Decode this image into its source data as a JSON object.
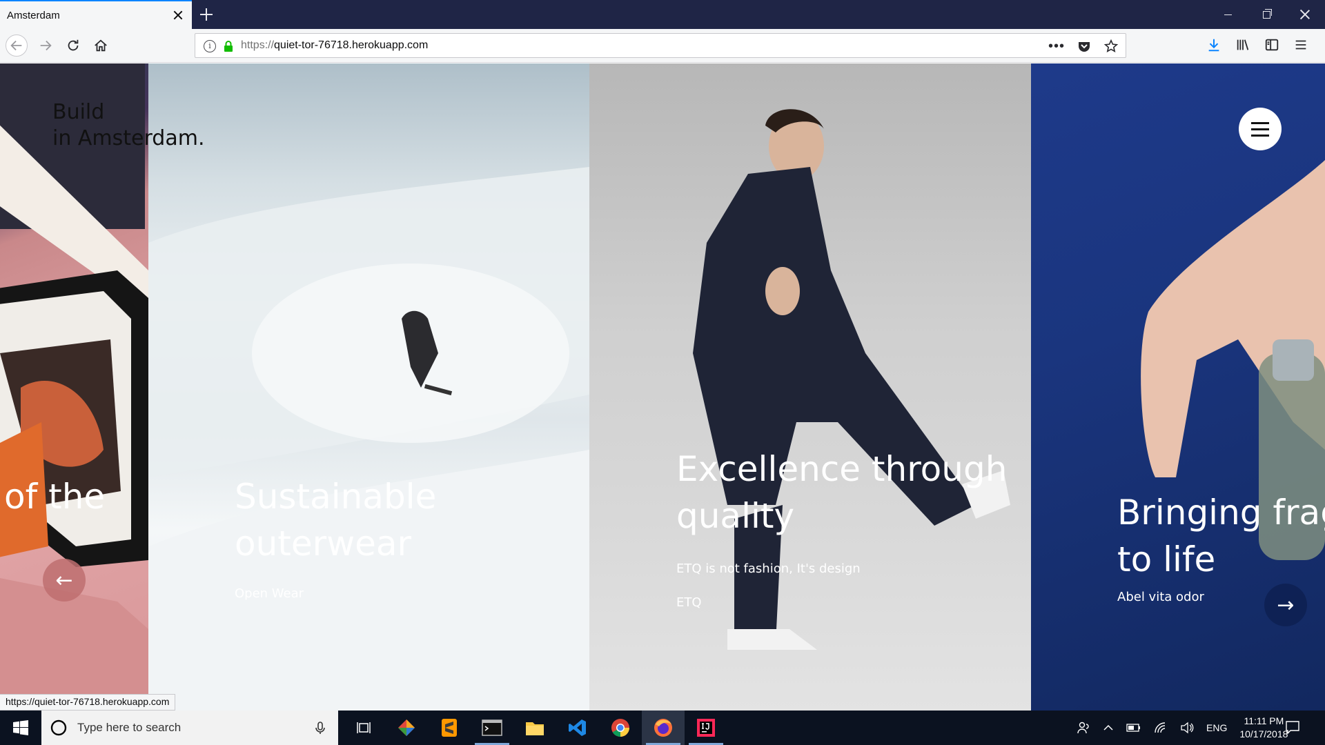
{
  "browser": {
    "tab_title": "Amsterdam",
    "url_scheme": "https://",
    "url_host": "quiet-tor-76718.herokuapp.com",
    "status_url": "https://quiet-tor-76718.herokuapp.com"
  },
  "page": {
    "brand_line1": "Build",
    "brand_line2": "in Amsterdam.",
    "slides": [
      {
        "title": "of the",
        "subtitle": "",
        "brand": ""
      },
      {
        "title_line1": "Sustainable",
        "title_line2": "outerwear",
        "subtitle": "",
        "brand": "Open Wear"
      },
      {
        "title_line1": "Excellence through",
        "title_line2": "quality",
        "subtitle": "ETQ is not fashion, It's design",
        "brand": "ETQ"
      },
      {
        "title_line1": "Bringing frag",
        "title_line2": "to life",
        "subtitle": "",
        "brand": "Abel vita odor"
      }
    ],
    "prev_arrow": "←",
    "next_arrow": "→"
  },
  "taskbar": {
    "search_placeholder": "Type here to search",
    "language": "ENG",
    "time": "11:11 PM",
    "date": "10/17/2018"
  }
}
